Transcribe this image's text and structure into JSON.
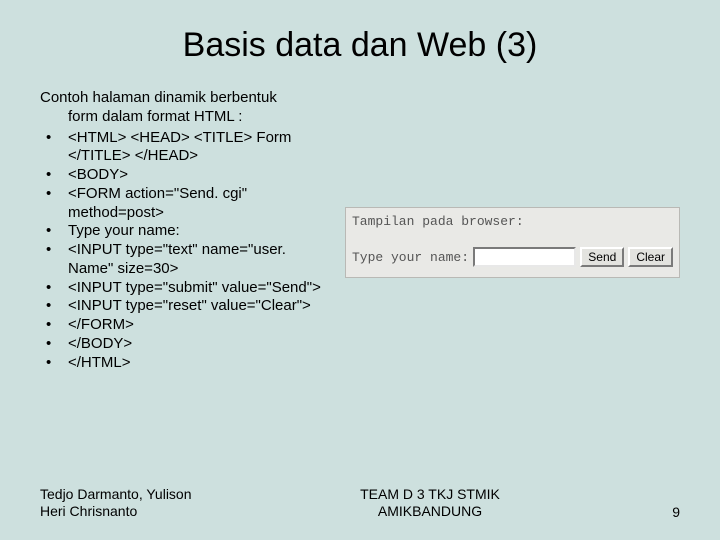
{
  "title": "Basis data dan Web (3)",
  "intro_line1": "Contoh halaman dinamik berbentuk",
  "intro_line2": "form dalam format HTML :",
  "bullets": [
    "<HTML> <HEAD> <TITLE>  Form </TITLE> </HEAD>",
    " <BODY>",
    "  <FORM action=\"Send. cgi\" method=post>",
    "   Type your name:",
    "   <INPUT type=\"text\" name=\"user. Name\" size=30>",
    "   <INPUT type=\"submit\" value=\"Send\">",
    "   <INPUT type=\"reset\" value=\"Clear\">",
    "  </FORM>",
    " </BODY>",
    "</HTML>"
  ],
  "browser": {
    "caption": "Tampilan pada browser:",
    "label": "Type your name:",
    "send": "Send",
    "clear": "Clear"
  },
  "footer": {
    "authors_l1": "Tedjo Darmanto, Yulison",
    "authors_l2": "Heri Chrisnanto",
    "team_l1": "TEAM D 3 TKJ STMIK",
    "team_l2": "AMIKBANDUNG",
    "page": "9"
  }
}
